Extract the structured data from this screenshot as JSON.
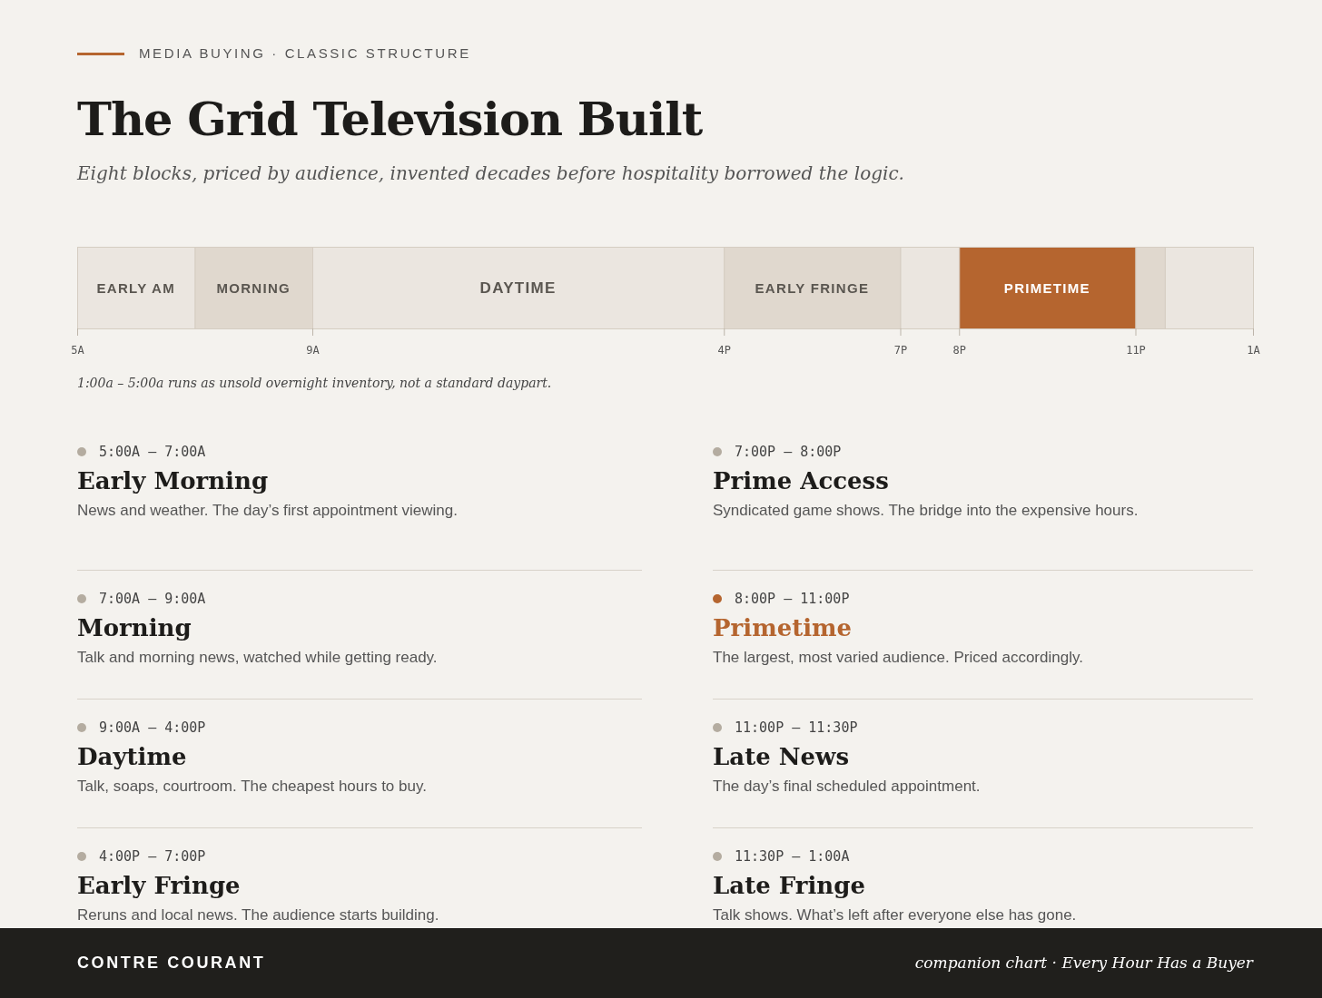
{
  "eyebrow": "MEDIA BUYING · CLASSIC STRUCTURE",
  "title": "The Grid Television Built",
  "subtitle": "Eight blocks, priced by audience, invented decades before hospitality borrowed the logic.",
  "timeline": {
    "segments": [
      {
        "label": "EARLY AM",
        "color": "#ebe6e0"
      },
      {
        "label": "MORNING",
        "color": "#e0d8ce"
      },
      {
        "label": "DAYTIME",
        "color": "#ebe6e0"
      },
      {
        "label": "EARLY FRINGE",
        "color": "#e0d8ce"
      },
      {
        "color": "#ebe6e0"
      },
      {
        "label": "PRIMETIME",
        "color": "#b5652f"
      },
      {
        "color": "#e0d8ce"
      },
      {
        "color": "#ebe6e0"
      }
    ],
    "ticks": [
      "5A",
      "9A",
      "4P",
      "7P",
      "8P",
      "11P",
      "1A"
    ],
    "note": "1:00a – 5:00a runs as unsold overnight inventory, not a standard daypart."
  },
  "dayparts": [
    {
      "time": "5:00A – 7:00A",
      "name": "Early Morning",
      "description": "News and weather. The day’s first appointment viewing.",
      "selected": false
    },
    {
      "time": "7:00A – 9:00A",
      "name": "Morning",
      "description": "Talk and morning news, watched while getting ready.",
      "selected": false
    },
    {
      "time": "9:00A – 4:00P",
      "name": "Daytime",
      "description": "Talk, soaps, courtroom. The cheapest hours to buy.",
      "selected": false
    },
    {
      "time": "4:00P – 7:00P",
      "name": "Early Fringe",
      "description": "Reruns and local news. The audience starts building.",
      "selected": false
    },
    {
      "time": "7:00P – 8:00P",
      "name": "Prime Access",
      "description": "Syndicated game shows. The bridge into the expensive hours.",
      "selected": false
    },
    {
      "time": "8:00P – 11:00P",
      "name": "Primetime",
      "description": "The largest, most varied audience. Priced accordingly.",
      "selected": true
    },
    {
      "time": "11:00P – 11:30P",
      "name": "Late News",
      "description": "The day’s final scheduled appointment.",
      "selected": false
    },
    {
      "time": "11:30P – 1:00A",
      "name": "Late Fringe",
      "description": "Talk shows. What’s left after everyone else has gone.",
      "selected": false
    }
  ],
  "footer": {
    "brand": "CONTRE COURANT",
    "tagline": "companion chart · Every Hour Has a Buyer"
  }
}
